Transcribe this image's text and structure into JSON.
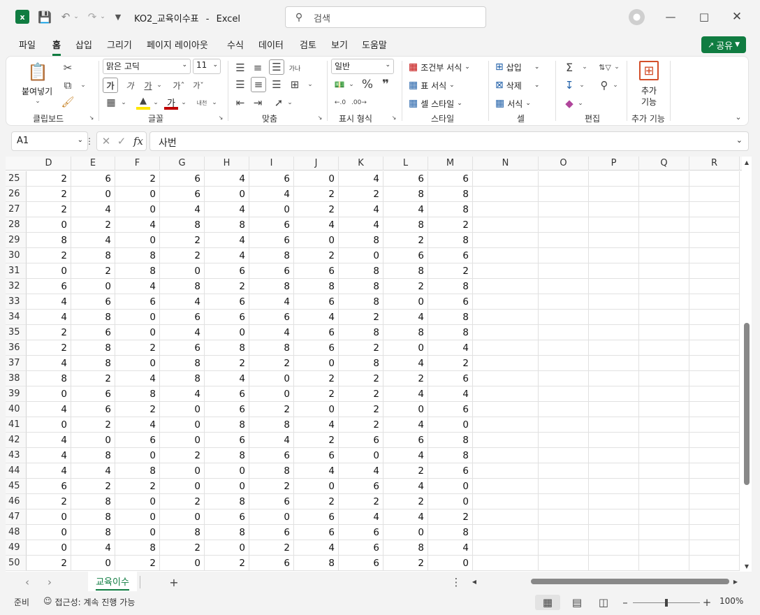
{
  "titlebar": {
    "filename": "KO2_교육이수표",
    "app_name": "Excel",
    "separator": "-",
    "search_placeholder": "검색"
  },
  "menu": [
    "파일",
    "홈",
    "삽입",
    "그리기",
    "페이지 레이아웃",
    "수식",
    "데이터",
    "검토",
    "보기",
    "도움말"
  ],
  "share_label": "공유",
  "ribbon": {
    "paste_label": "붙여넣기",
    "font_name": "맑은 고딕",
    "font_size": "11",
    "number_format": "일반",
    "conditional_format": "조건부 서식",
    "format_as_table": "표 서식",
    "cell_styles": "셀 스타일",
    "insert": "삽입",
    "delete": "삭제",
    "format": "서식",
    "addins_line1": "추가",
    "addins_line2": "기능",
    "groups": {
      "clipboard": "클립보드",
      "font": "글꼴",
      "alignment": "맞춤",
      "number": "표시 형식",
      "styles": "스타일",
      "cells": "셀",
      "editing": "편집",
      "addins": "추가 기능"
    }
  },
  "formula_bar": {
    "name_box": "A1",
    "fx": "fx",
    "value": "사번"
  },
  "columns": [
    "D",
    "E",
    "F",
    "G",
    "H",
    "I",
    "J",
    "K",
    "L",
    "M",
    "N",
    "O",
    "P",
    "Q",
    "R"
  ],
  "rows": [
    {
      "n": "25",
      "v": [
        "2",
        "6",
        "2",
        "6",
        "4",
        "6",
        "0",
        "4",
        "6",
        "6"
      ]
    },
    {
      "n": "26",
      "v": [
        "2",
        "0",
        "0",
        "6",
        "0",
        "4",
        "2",
        "2",
        "8",
        "8"
      ]
    },
    {
      "n": "27",
      "v": [
        "2",
        "4",
        "0",
        "4",
        "4",
        "0",
        "2",
        "4",
        "4",
        "8"
      ]
    },
    {
      "n": "28",
      "v": [
        "0",
        "2",
        "4",
        "8",
        "8",
        "6",
        "4",
        "4",
        "8",
        "2"
      ]
    },
    {
      "n": "29",
      "v": [
        "8",
        "4",
        "0",
        "2",
        "4",
        "6",
        "0",
        "8",
        "2",
        "8"
      ]
    },
    {
      "n": "30",
      "v": [
        "2",
        "8",
        "8",
        "2",
        "4",
        "8",
        "2",
        "0",
        "6",
        "6"
      ]
    },
    {
      "n": "31",
      "v": [
        "0",
        "2",
        "8",
        "0",
        "6",
        "6",
        "6",
        "8",
        "8",
        "2"
      ]
    },
    {
      "n": "32",
      "v": [
        "6",
        "0",
        "4",
        "8",
        "2",
        "8",
        "8",
        "8",
        "2",
        "8"
      ]
    },
    {
      "n": "33",
      "v": [
        "4",
        "6",
        "6",
        "4",
        "6",
        "4",
        "6",
        "8",
        "0",
        "6"
      ]
    },
    {
      "n": "34",
      "v": [
        "4",
        "8",
        "0",
        "6",
        "6",
        "6",
        "4",
        "2",
        "4",
        "8"
      ]
    },
    {
      "n": "35",
      "v": [
        "2",
        "6",
        "0",
        "4",
        "0",
        "4",
        "6",
        "8",
        "8",
        "8"
      ]
    },
    {
      "n": "36",
      "v": [
        "2",
        "8",
        "2",
        "6",
        "8",
        "8",
        "6",
        "2",
        "0",
        "4"
      ]
    },
    {
      "n": "37",
      "v": [
        "4",
        "8",
        "0",
        "8",
        "2",
        "2",
        "0",
        "8",
        "4",
        "2"
      ]
    },
    {
      "n": "38",
      "v": [
        "8",
        "2",
        "4",
        "8",
        "4",
        "0",
        "2",
        "2",
        "2",
        "6"
      ]
    },
    {
      "n": "39",
      "v": [
        "0",
        "6",
        "8",
        "4",
        "6",
        "0",
        "2",
        "2",
        "4",
        "4"
      ]
    },
    {
      "n": "40",
      "v": [
        "4",
        "6",
        "2",
        "0",
        "6",
        "2",
        "0",
        "2",
        "0",
        "6"
      ]
    },
    {
      "n": "41",
      "v": [
        "0",
        "2",
        "4",
        "0",
        "8",
        "8",
        "4",
        "2",
        "4",
        "0"
      ]
    },
    {
      "n": "42",
      "v": [
        "4",
        "0",
        "6",
        "0",
        "6",
        "4",
        "2",
        "6",
        "6",
        "8"
      ]
    },
    {
      "n": "43",
      "v": [
        "4",
        "8",
        "0",
        "2",
        "8",
        "6",
        "6",
        "0",
        "4",
        "8"
      ]
    },
    {
      "n": "44",
      "v": [
        "4",
        "4",
        "8",
        "0",
        "0",
        "8",
        "4",
        "4",
        "2",
        "6"
      ]
    },
    {
      "n": "45",
      "v": [
        "6",
        "2",
        "2",
        "0",
        "0",
        "2",
        "0",
        "6",
        "4",
        "0"
      ]
    },
    {
      "n": "46",
      "v": [
        "2",
        "8",
        "0",
        "2",
        "8",
        "6",
        "2",
        "2",
        "2",
        "0"
      ]
    },
    {
      "n": "47",
      "v": [
        "0",
        "8",
        "0",
        "0",
        "6",
        "0",
        "6",
        "4",
        "4",
        "2"
      ]
    },
    {
      "n": "48",
      "v": [
        "0",
        "8",
        "0",
        "8",
        "8",
        "6",
        "6",
        "6",
        "0",
        "8"
      ]
    },
    {
      "n": "49",
      "v": [
        "0",
        "4",
        "8",
        "2",
        "0",
        "2",
        "4",
        "6",
        "8",
        "4"
      ]
    },
    {
      "n": "50",
      "v": [
        "2",
        "0",
        "2",
        "0",
        "2",
        "6",
        "8",
        "6",
        "2",
        "0"
      ]
    }
  ],
  "sheet_tab": "교육이수",
  "status": {
    "ready": "준비",
    "accessibility": "접근성: 계속 진행 가능",
    "zoom": "100%"
  },
  "colors": {
    "excel_green": "#107c41",
    "share_green": "#107c41",
    "font_red": "#c00000",
    "highlight_yellow": "#ffe600"
  }
}
